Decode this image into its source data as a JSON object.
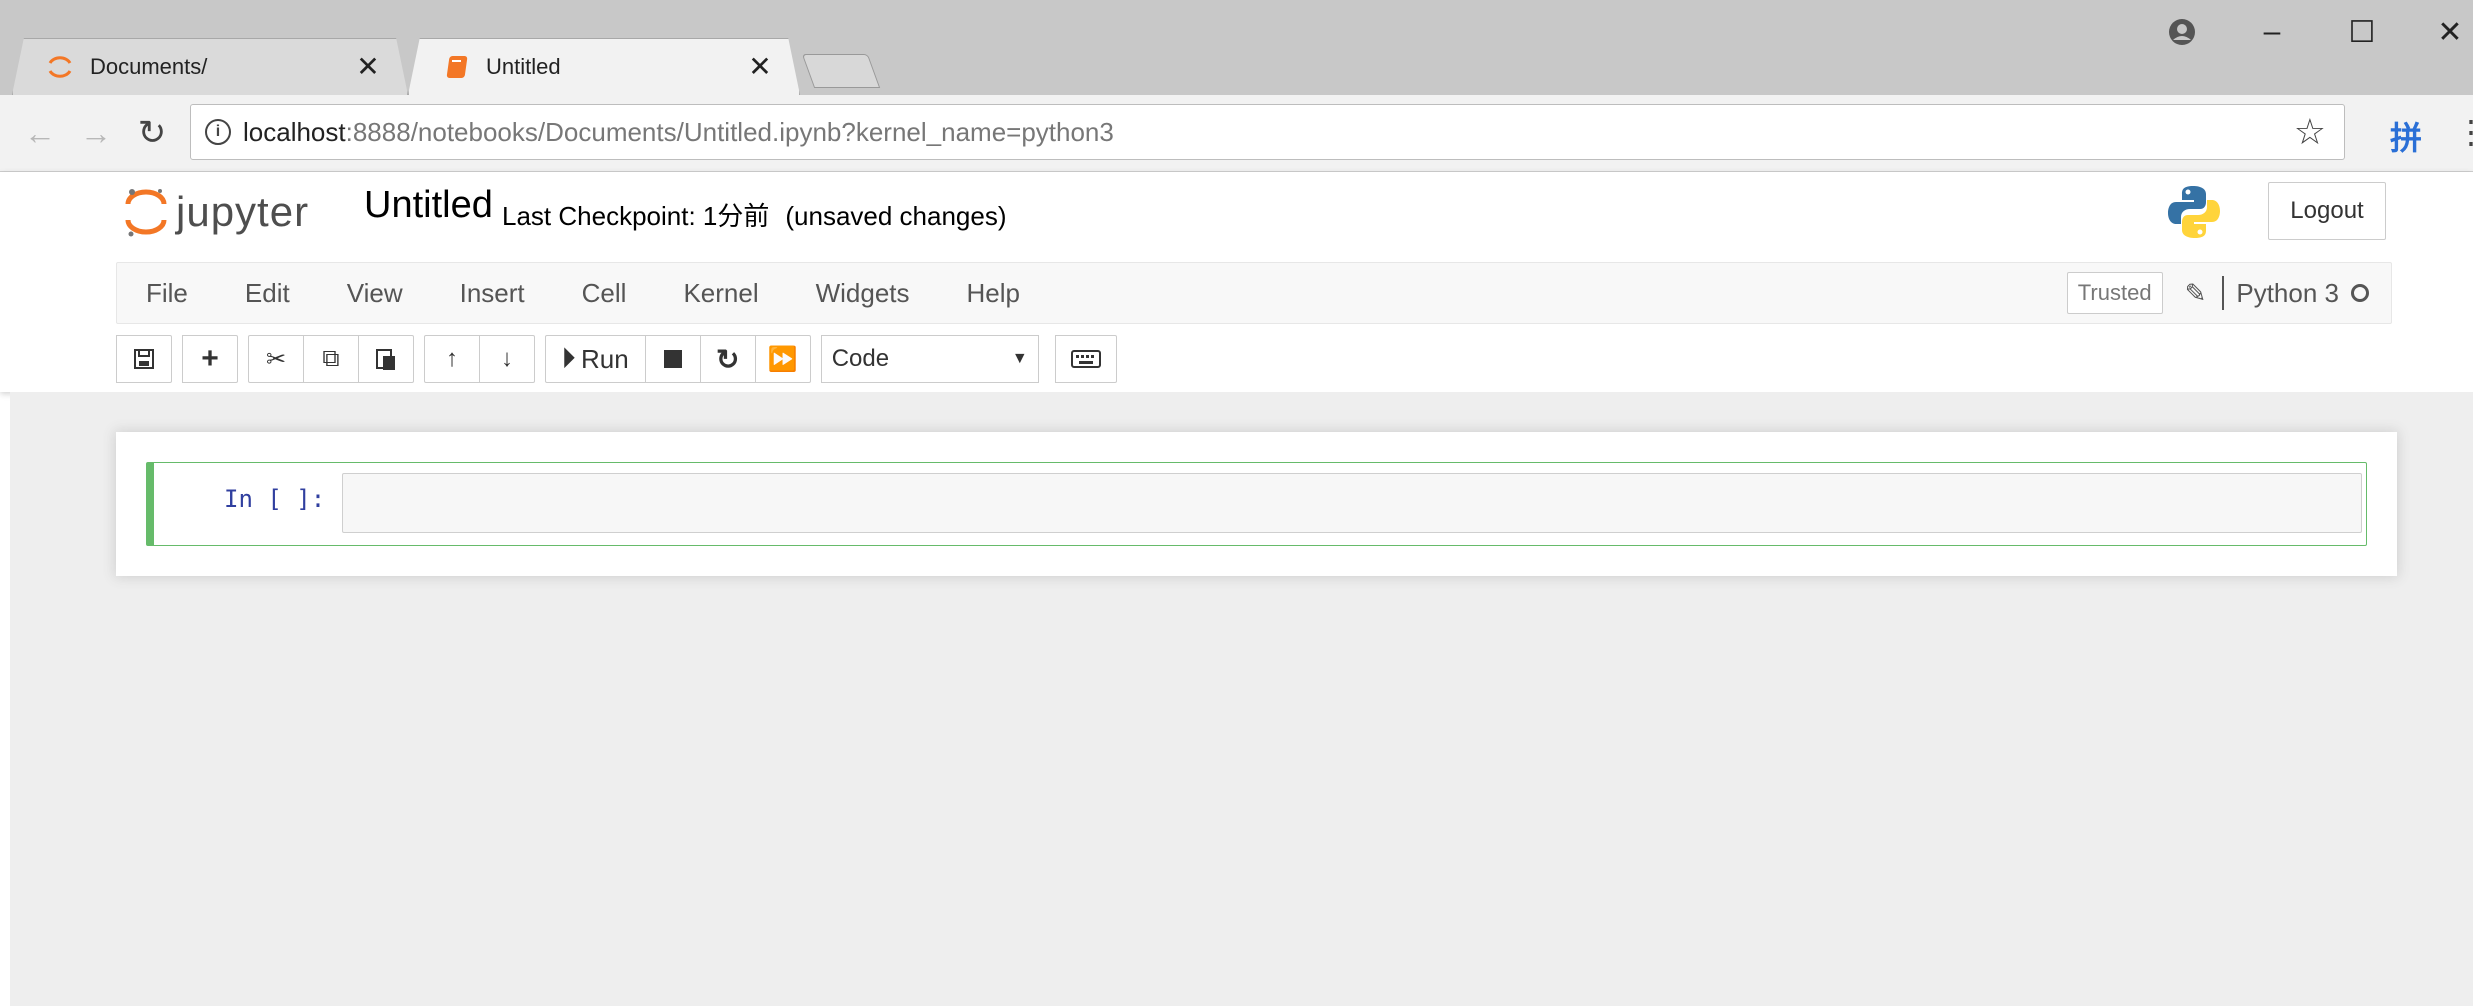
{
  "browser": {
    "tabs": [
      {
        "title": "Documents/",
        "icon": "jupyter-logo-icon",
        "active": false
      },
      {
        "title": "Untitled",
        "icon": "notebook-icon",
        "active": true
      }
    ],
    "url_host": "localhost",
    "url_rest": ":8888/notebooks/Documents/Untitled.ipynb?kernel_name=python3",
    "extension_glyph": "拼"
  },
  "jupyter": {
    "logo_text": "jupyter",
    "notebook_title": "Untitled",
    "checkpoint": "Last Checkpoint: 1分前",
    "unsaved": "(unsaved changes)",
    "logout": "Logout",
    "menu": [
      "File",
      "Edit",
      "View",
      "Insert",
      "Cell",
      "Kernel",
      "Widgets",
      "Help"
    ],
    "trusted": "Trusted",
    "kernel": "Python 3",
    "toolbar": {
      "run_label": "Run",
      "cell_type": "Code"
    }
  },
  "cell": {
    "prompt": "In [ ]:",
    "source": ""
  },
  "colors": {
    "jupyter_orange": "#f37726",
    "cell_selected_border": "#66bb6a",
    "prompt_color": "#303f9f"
  }
}
